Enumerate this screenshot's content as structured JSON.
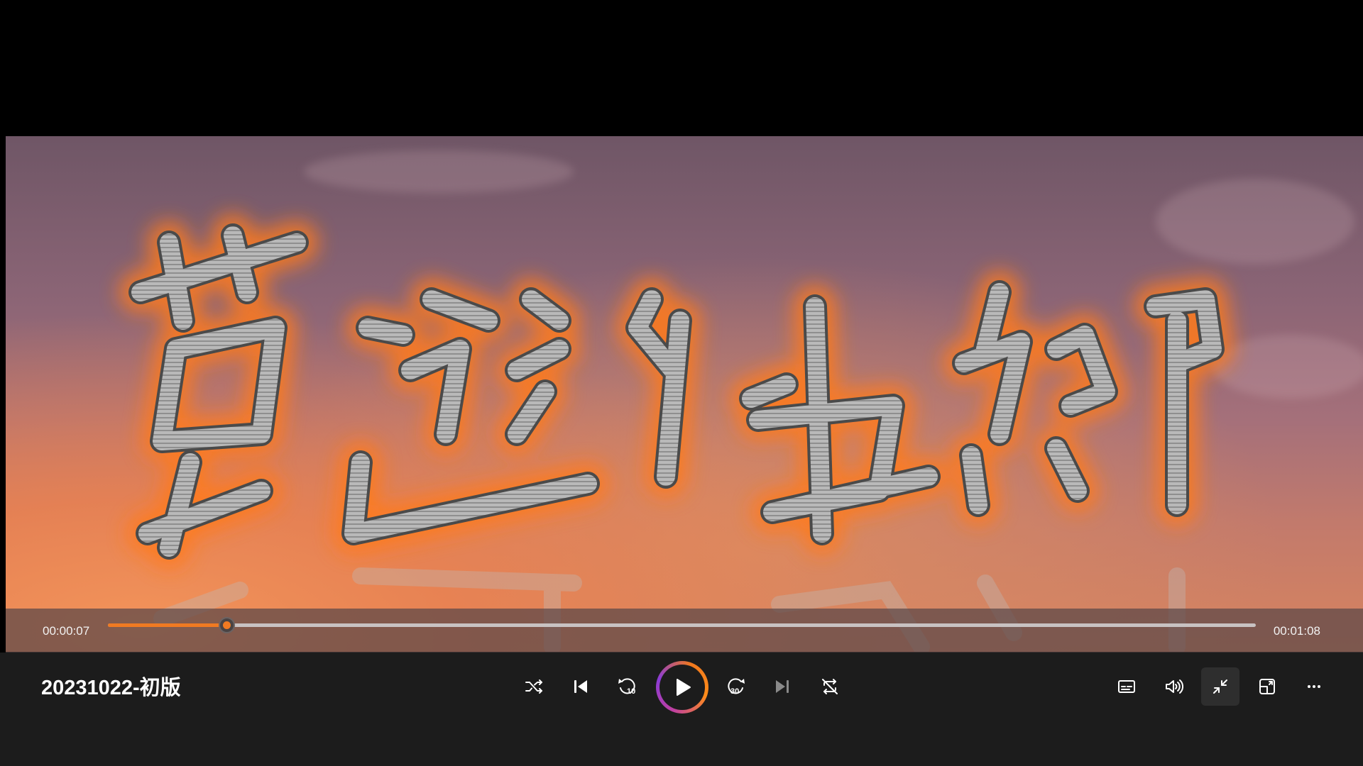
{
  "video": {
    "caption_chars": "夢遊他鄉",
    "caption_style": "stylized-gray-calligraphy-with-orange-glow"
  },
  "timeline": {
    "current_time": "00:00:07",
    "total_time": "00:01:08",
    "progress_fraction": 0.103
  },
  "media": {
    "title": "20231022-初版"
  },
  "controls": {
    "shuffle_icon": "shuffle-icon",
    "previous_icon": "previous-track-icon",
    "rewind_icon": "rewind-10-icon",
    "rewind_seconds": "10",
    "play_icon": "play-icon",
    "forward_icon": "forward-30-icon",
    "forward_seconds": "30",
    "next_icon": "next-track-icon",
    "repeat_icon": "repeat-off-icon",
    "captions_icon": "captions-icon",
    "volume_icon": "volume-icon",
    "exit_fullscreen_icon": "exit-fullscreen-icon",
    "miniplayer_icon": "miniplayer-icon",
    "more_icon": "more-options-icon"
  },
  "colors": {
    "accent": "#f07a22",
    "play_ring": [
      "#c040a0",
      "#8a3bd6",
      "#f0781e"
    ],
    "bar_bg": "#1c1c1c"
  }
}
